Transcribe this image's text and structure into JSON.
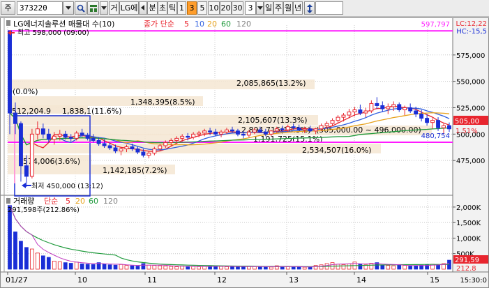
{
  "toolbar": {
    "market": "주",
    "code": "373220",
    "type_label": "거",
    "stock_name": "LG에",
    "period_unit": "분",
    "tick_label": "초",
    "tick2_label": "틱",
    "intervals": [
      "1",
      "3",
      "5",
      "10",
      "20",
      "30"
    ],
    "selected_interval": "3",
    "count": "3",
    "ranges": [
      "일",
      "주",
      "월",
      "년"
    ]
  },
  "colors": {
    "up": "#e8252e",
    "down": "#1a2ed6",
    "ma5": "#e8252e",
    "ma10": "#2f5fe0",
    "ma20": "#e8a21c",
    "ma60": "#1f9a3c",
    "ma120": "#808080",
    "magenta": "#ff1aff",
    "label_bg": "#f5e6d2"
  },
  "price_panel": {
    "legend": {
      "title": "LG에너지솔루션 매물대 수(10)",
      "ma_title": "종가 단순",
      "periods": [
        "5",
        "10",
        "20",
        "60",
        "120"
      ]
    },
    "lc_label": "LC:12,22",
    "hc_label": "HC:-15,5",
    "top_price": "597,797",
    "high_label": "최고 598,000 (09:00)",
    "low_label": "최저 450,000 (13:12)",
    "current_price": "505,00",
    "change_pct": "1.51%",
    "ma_value": "480,754",
    "y_ticks": [
      "575,000",
      "550,000",
      "525,000",
      "500,000",
      "475,000"
    ],
    "volume_profile": [
      "0(0.0%)",
      "2,085,865(13.2%)",
      "1,348,395(8.5%)",
      "512,204.9",
      "1,838,1(11.6%)",
      "2,105,607(13.3%)",
      "2,894,716(18.3%)",
      "(505,000.00 ~ 496,000.00)",
      "1,191,725(15.1%)",
      "574,006(3.6%)",
      "2,534,507(16.0%)",
      "1,142,185(7.2%)"
    ]
  },
  "volume_panel": {
    "legend": {
      "title": "거래량",
      "ma_title": "단순",
      "periods": [
        "5",
        "20",
        "60",
        "120"
      ]
    },
    "subtitle": "291,598주(212.86%)",
    "y_ticks": [
      "2,000K",
      "1,500K",
      "1,000K",
      "500K"
    ],
    "last_volume": "291,59",
    "last_pct": "212.8"
  },
  "x_axis": {
    "labels": [
      "01/27",
      "10",
      "11",
      "12",
      "13",
      "14",
      "15"
    ],
    "end_time": "15:30:0"
  },
  "chart_data": {
    "type": "candlestick",
    "price_range": [
      450000,
      598000
    ],
    "series": [
      {
        "name": "가격",
        "values": [
          [
            598000,
            598000,
            500000,
            520000
          ],
          [
            520000,
            530000,
            500000,
            510000
          ],
          [
            510000,
            512000,
            455000,
            470000
          ],
          [
            470000,
            480000,
            450000,
            460000
          ],
          [
            460000,
            505000,
            458000,
            500000
          ],
          [
            500000,
            512000,
            495000,
            505000
          ],
          [
            505000,
            510000,
            496000,
            500000
          ],
          [
            500000,
            505000,
            492000,
            495000
          ],
          [
            495000,
            502000,
            490000,
            498000
          ],
          [
            498000,
            504000,
            494000,
            500000
          ],
          [
            500000,
            503000,
            495000,
            497000
          ],
          [
            497000,
            500000,
            493000,
            496000
          ],
          [
            496000,
            503000,
            494000,
            501000
          ],
          [
            501000,
            505000,
            497000,
            499000
          ],
          [
            499000,
            501000,
            494000,
            496000
          ],
          [
            496000,
            500000,
            492000,
            494000
          ],
          [
            494000,
            497000,
            489000,
            491000
          ],
          [
            491000,
            495000,
            487000,
            489000
          ],
          [
            489000,
            492000,
            485000,
            487000
          ],
          [
            487000,
            490000,
            482000,
            484000
          ],
          [
            484000,
            488000,
            480000,
            486000
          ],
          [
            486000,
            490000,
            483000,
            488000
          ],
          [
            488000,
            491000,
            484000,
            486000
          ],
          [
            486000,
            488000,
            481000,
            483000
          ],
          [
            483000,
            486000,
            478000,
            480000
          ],
          [
            480000,
            484000,
            477000,
            482000
          ],
          [
            482000,
            488000,
            480000,
            486000
          ],
          [
            486000,
            491000,
            484000,
            489000
          ],
          [
            489000,
            494000,
            487000,
            492000
          ],
          [
            492000,
            496000,
            489000,
            494000
          ],
          [
            494000,
            498000,
            491000,
            496000
          ],
          [
            496000,
            500000,
            493000,
            498000
          ],
          [
            498000,
            501000,
            494000,
            497000
          ],
          [
            497000,
            502000,
            495000,
            500000
          ],
          [
            500000,
            503000,
            497000,
            501000
          ],
          [
            501000,
            505000,
            498000,
            503000
          ],
          [
            503000,
            506000,
            499000,
            502000
          ],
          [
            502000,
            505000,
            498000,
            500000
          ],
          [
            500000,
            504000,
            497000,
            502000
          ],
          [
            502000,
            506000,
            500000,
            504000
          ],
          [
            504000,
            507000,
            501000,
            503000
          ],
          [
            503000,
            505000,
            498000,
            500000
          ],
          [
            500000,
            503000,
            496000,
            499000
          ],
          [
            499000,
            504000,
            497000,
            502000
          ],
          [
            502000,
            506000,
            500000,
            504000
          ],
          [
            504000,
            507000,
            501000,
            502000
          ],
          [
            502000,
            505000,
            498000,
            500000
          ],
          [
            500000,
            504000,
            498000,
            503000
          ],
          [
            503000,
            507000,
            501000,
            505000
          ],
          [
            505000,
            508000,
            502000,
            504000
          ],
          [
            504000,
            509000,
            502000,
            507000
          ],
          [
            507000,
            510000,
            504000,
            506000
          ],
          [
            506000,
            509000,
            503000,
            504000
          ],
          [
            504000,
            507000,
            501000,
            505000
          ],
          [
            505000,
            508000,
            502000,
            503000
          ],
          [
            503000,
            506000,
            500000,
            505000
          ],
          [
            505000,
            510000,
            503000,
            508000
          ],
          [
            508000,
            512000,
            505000,
            510000
          ],
          [
            510000,
            515000,
            508000,
            513000
          ],
          [
            513000,
            518000,
            510000,
            516000
          ],
          [
            516000,
            520000,
            512000,
            518000
          ],
          [
            518000,
            524000,
            515000,
            521000
          ],
          [
            521000,
            526000,
            517000,
            523000
          ],
          [
            523000,
            528000,
            518000,
            520000
          ],
          [
            520000,
            525000,
            516000,
            522000
          ],
          [
            522000,
            532000,
            520000,
            529000
          ],
          [
            529000,
            535000,
            524000,
            527000
          ],
          [
            527000,
            531000,
            521000,
            524000
          ],
          [
            524000,
            529000,
            519000,
            526000
          ],
          [
            526000,
            531000,
            522000,
            528000
          ],
          [
            528000,
            530000,
            521000,
            523000
          ],
          [
            523000,
            527000,
            518000,
            525000
          ],
          [
            525000,
            529000,
            520000,
            522000
          ],
          [
            522000,
            526000,
            516000,
            519000
          ],
          [
            519000,
            523000,
            512000,
            515000
          ],
          [
            515000,
            519000,
            508000,
            511000
          ],
          [
            511000,
            515000,
            505000,
            513000
          ],
          [
            513000,
            516000,
            503000,
            506000
          ],
          [
            506000,
            510000,
            500000,
            508000
          ],
          [
            508000,
            511000,
            502000,
            505000
          ]
        ]
      },
      {
        "name": "거래량",
        "values": [
          2050,
          1200,
          900,
          700,
          650,
          520,
          430,
          380,
          260,
          240,
          210,
          190,
          230,
          170,
          160,
          150,
          210,
          170,
          140,
          130,
          150,
          120,
          110,
          100,
          180,
          130,
          120,
          110,
          100,
          90,
          80,
          100,
          90,
          85,
          80,
          90,
          95,
          110,
          90,
          80,
          75,
          70,
          95,
          90,
          85,
          80,
          75,
          70,
          110,
          90,
          80,
          75,
          70,
          65,
          80,
          120,
          140,
          180,
          210,
          160,
          150,
          170,
          230,
          160,
          140,
          190,
          210,
          130,
          120,
          110,
          150,
          120,
          100,
          110,
          130,
          140,
          160,
          150,
          180,
          290
        ]
      }
    ]
  }
}
